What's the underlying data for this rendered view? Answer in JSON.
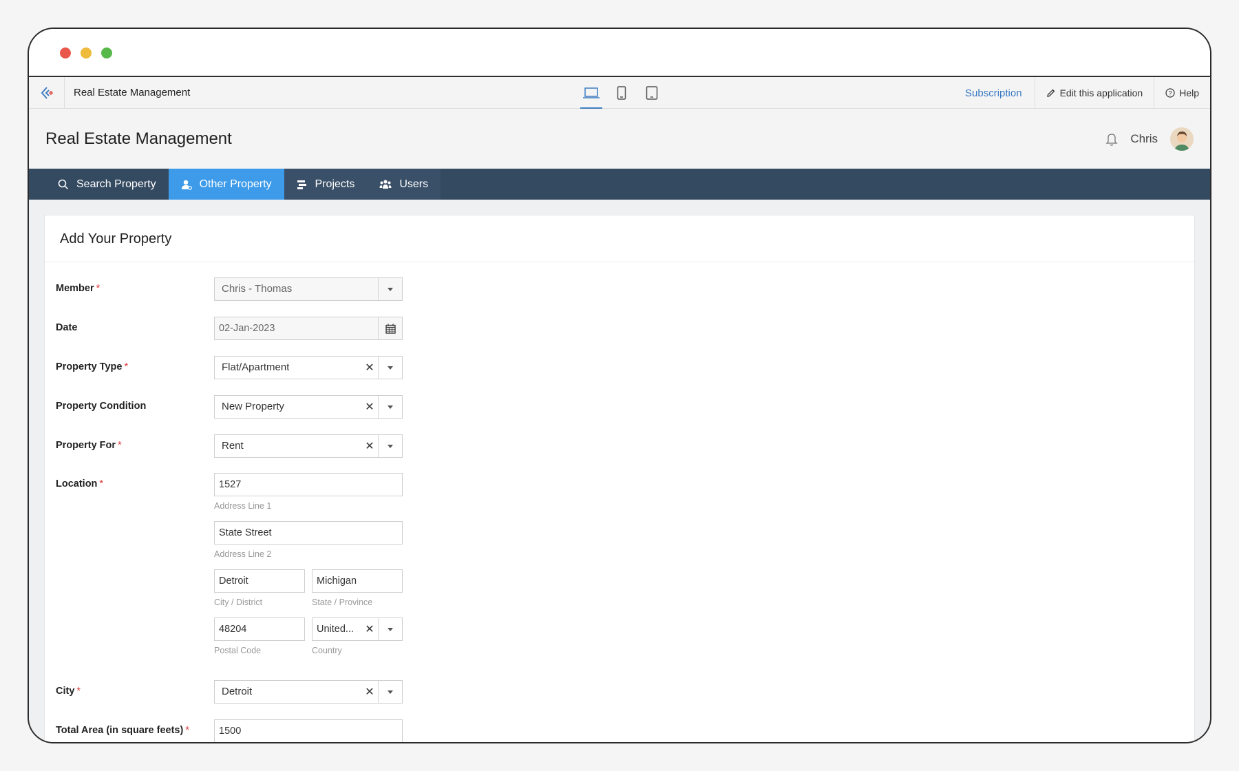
{
  "app_bar": {
    "app_name": "Real Estate Management",
    "subscription": "Subscription",
    "edit_app": "Edit this application",
    "help": "Help"
  },
  "header": {
    "title": "Real Estate Management",
    "user_name": "Chris"
  },
  "nav": [
    {
      "label": "Search Property",
      "icon": "search-icon"
    },
    {
      "label": "Other Property",
      "icon": "user-icon"
    },
    {
      "label": "Projects",
      "icon": "projects-icon"
    },
    {
      "label": "Users",
      "icon": "users-icon"
    }
  ],
  "form": {
    "title": "Add Your Property",
    "member": {
      "label": "Member",
      "value": "Chris - Thomas"
    },
    "date": {
      "label": "Date",
      "value": "02-Jan-2023"
    },
    "property_type": {
      "label": "Property Type",
      "value": "Flat/Apartment"
    },
    "property_condition": {
      "label": "Property Condition",
      "value": "New Property"
    },
    "property_for": {
      "label": "Property For",
      "value": "Rent"
    },
    "location": {
      "label": "Location",
      "address_line1": "1527",
      "address_line1_hint": "Address Line 1",
      "address_line2": "State Street",
      "address_line2_hint": "Address Line 2",
      "city": "Detroit",
      "city_hint": "City / District",
      "state": "Michigan",
      "state_hint": "State / Province",
      "postal": "48204",
      "postal_hint": "Postal Code",
      "country": "United...",
      "country_hint": "Country"
    },
    "city": {
      "label": "City",
      "value": "Detroit"
    },
    "total_area": {
      "label": "Total Area (in square feets)",
      "value": "1500"
    }
  },
  "colors": {
    "nav_bg": "#344a61",
    "nav_active": "#3d9be9",
    "link_blue": "#3a7ac2",
    "required_red": "#e03c3c"
  }
}
